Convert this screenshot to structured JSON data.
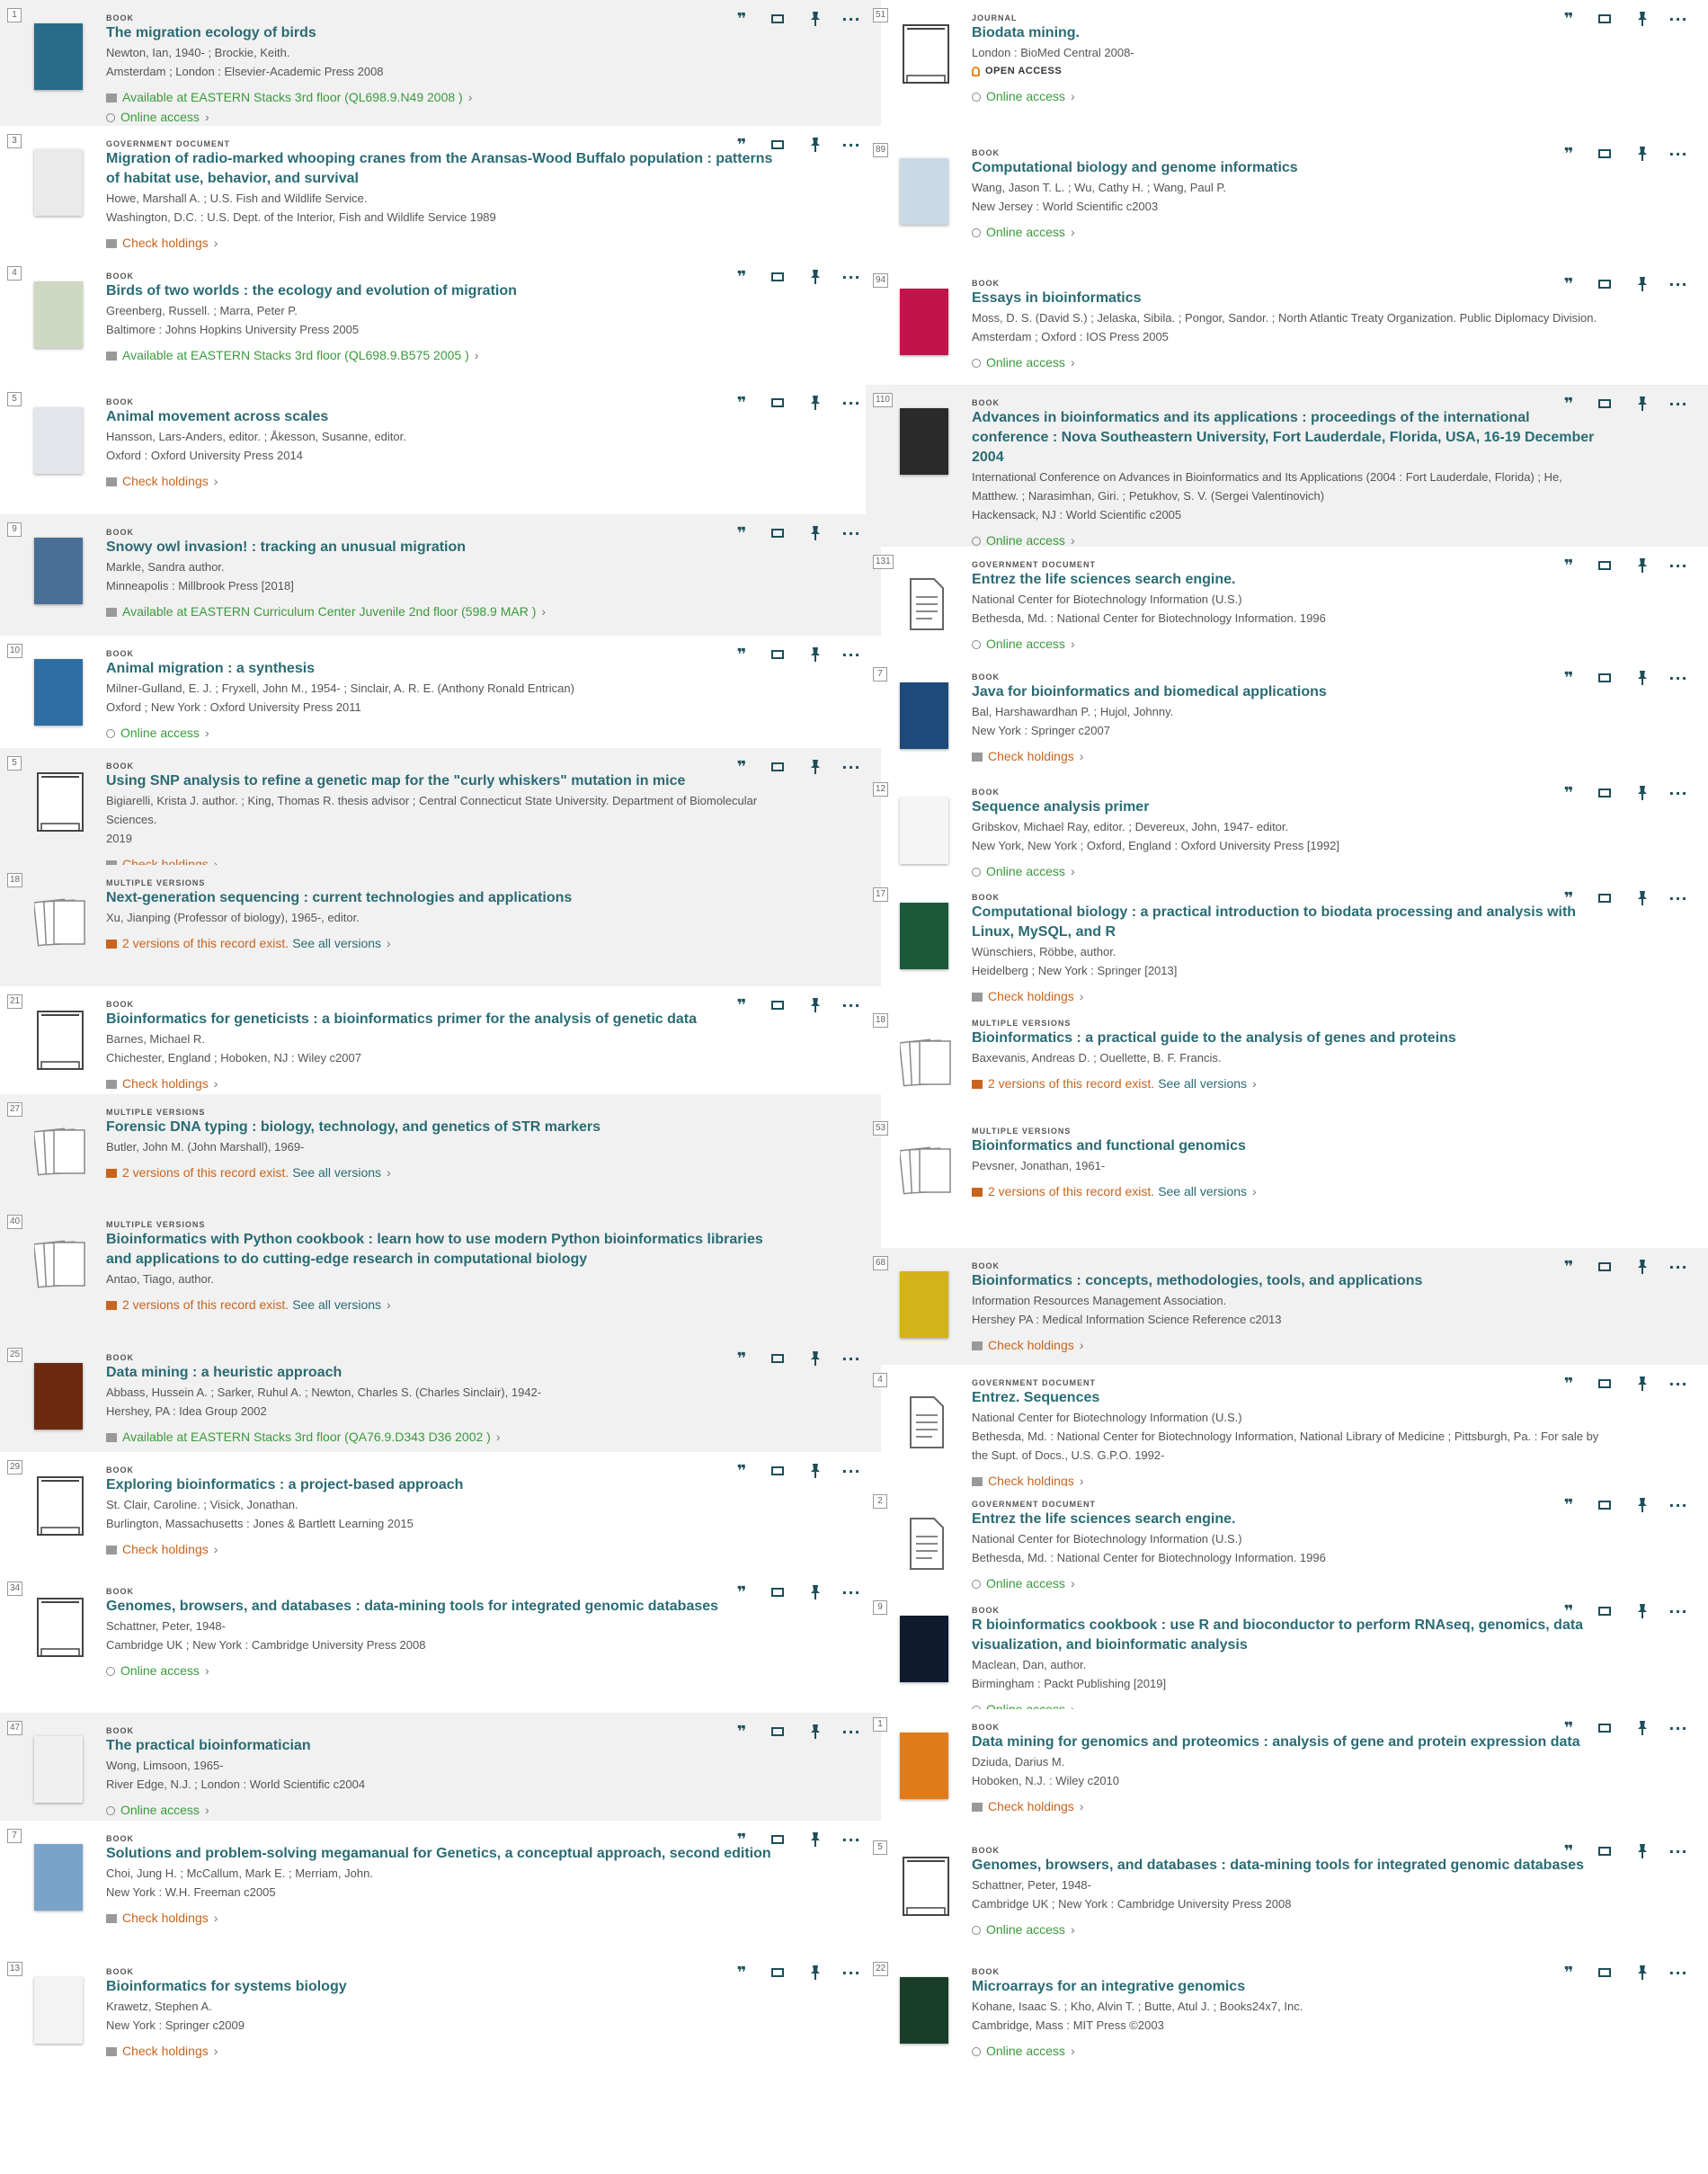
{
  "actions": {
    "cite_icon": "cite-icon",
    "email_icon": "email-icon",
    "pin_icon": "pin-icon",
    "more_icon": "more-icon",
    "cite_glyph": "❞",
    "pin_glyph": "📌",
    "more_glyph": "···"
  },
  "left": [
    {
      "num": "1",
      "type": "BOOK",
      "title": "The migration ecology of birds",
      "author": "Newton, Ian, 1940- ; Brockie, Keith.",
      "pub": "Amsterdam ; London : Elsevier-Academic Press 2008",
      "status": "Available at EASTERN  Stacks 3rd floor (QL698.9.N49 2008 )",
      "status2": "Online access"
    },
    {
      "num": "3",
      "type": "GOVERNMENT DOCUMENT",
      "title": "Migration of radio-marked whooping cranes from the Aransas-Wood Buffalo population : patterns of habitat use, behavior, and survival",
      "author": "Howe, Marshall A. ; U.S. Fish and Wildlife Service.",
      "pub": "Washington, D.C. : U.S. Dept. of the Interior, Fish and Wildlife Service 1989",
      "status": "Check holdings"
    },
    {
      "num": "4",
      "type": "BOOK",
      "title": "Birds of two worlds : the ecology and evolution of migration",
      "author": "Greenberg, Russell. ; Marra, Peter P.",
      "pub": "Baltimore : Johns Hopkins University Press 2005",
      "status": "Available at EASTERN  Stacks 3rd floor (QL698.9.B575 2005 )"
    },
    {
      "num": "5",
      "type": "BOOK",
      "title": "Animal movement across scales",
      "author": "Hansson, Lars-Anders, editor. ; Åkesson, Susanne, editor.",
      "pub": "Oxford : Oxford University Press 2014",
      "status": "Check holdings"
    },
    {
      "num": "9",
      "type": "BOOK",
      "title": "Snowy owl invasion! : tracking an unusual migration",
      "author": "Markle, Sandra author.",
      "pub": "Minneapolis : Millbrook Press [2018]",
      "status": "Available at EASTERN  Curriculum Center Juvenile 2nd floor (598.9 MAR )"
    },
    {
      "num": "10",
      "type": "BOOK",
      "title": "Animal migration : a synthesis",
      "author": "Milner-Gulland, E. J. ; Fryxell, John M., 1954- ; Sinclair, A. R. E. (Anthony Ronald Entrican)",
      "pub": "Oxford ; New York : Oxford University Press 2011",
      "status": "Online access"
    },
    {
      "num": "5",
      "type": "BOOK",
      "title": "Using SNP analysis to refine a genetic map for the \"curly whiskers\" mutation in mice",
      "author": "Bigiarelli, Krista J. author. ; King, Thomas R. thesis advisor ; Central Connecticut State University. Department of Biomolecular Sciences.",
      "pub": "2019",
      "status": "Check holdings"
    },
    {
      "num": "18",
      "type": "MULTIPLE VERSIONS",
      "title": "Next-generation sequencing : current technologies and applications",
      "author": "Xu, Jianping (Professor of biology), 1965-, editor.",
      "pub": "",
      "status": "2 versions of this record exist.",
      "see": "See all versions"
    },
    {
      "num": "21",
      "type": "BOOK",
      "title": "Bioinformatics for geneticists : a bioinformatics primer for the analysis of genetic data",
      "author": "Barnes, Michael R.",
      "pub": "Chichester, England ; Hoboken, NJ : Wiley c2007",
      "status": "Check holdings"
    },
    {
      "num": "27",
      "type": "MULTIPLE VERSIONS",
      "title": "Forensic DNA typing : biology, technology, and genetics of STR markers",
      "author": "Butler, John M. (John Marshall), 1969-",
      "pub": "",
      "status": "2 versions of this record exist.",
      "see": "See all versions"
    },
    {
      "num": "40",
      "type": "MULTIPLE VERSIONS",
      "title": "Bioinformatics with Python cookbook : learn how to use modern Python bioinformatics libraries and applications to do cutting-edge research in computational biology",
      "author": "Antao, Tiago, author.",
      "pub": "",
      "status": "2 versions of this record exist.",
      "see": "See all versions"
    },
    {
      "num": "25",
      "type": "BOOK",
      "title": "Data mining : a heuristic approach",
      "author": "Abbass, Hussein A. ; Sarker, Ruhul A. ; Newton, Charles S. (Charles Sinclair), 1942-",
      "pub": "Hershey, PA : Idea Group 2002",
      "status": "Available at EASTERN  Stacks 3rd floor (QA76.9.D343 D36 2002 )"
    },
    {
      "num": "29",
      "type": "BOOK",
      "title": "Exploring bioinformatics : a project-based approach",
      "author": "St. Clair, Caroline. ; Visick, Jonathan.",
      "pub": "Burlington, Massachusetts : Jones & Bartlett Learning 2015",
      "status": "Check holdings"
    },
    {
      "num": "34",
      "type": "BOOK",
      "title": "Genomes, browsers, and databases : data-mining tools for integrated genomic databases",
      "author": "Schattner, Peter, 1948-",
      "pub": "Cambridge UK ; New York : Cambridge University Press 2008",
      "status": "Online access"
    },
    {
      "num": "47",
      "type": "BOOK",
      "title": "The practical bioinformatician",
      "author": "Wong, Limsoon, 1965-",
      "pub": "River Edge, N.J. ; London : World Scientific c2004",
      "status": "Online access"
    },
    {
      "num": "7",
      "type": "BOOK",
      "title": "Solutions and problem-solving megamanual for Genetics, a conceptual approach, second edition",
      "author": "Choi, Jung H. ; McCallum, Mark E. ; Merriam, John.",
      "pub": "New York : W.H. Freeman c2005",
      "status": "Check holdings"
    },
    {
      "num": "13",
      "type": "BOOK",
      "title": "Bioinformatics for systems biology",
      "author": "Krawetz, Stephen A.",
      "pub": "New York : Springer c2009",
      "status": "Check holdings"
    }
  ],
  "right": [
    {
      "num": "51",
      "type": "JOURNAL",
      "title": "Biodata mining.",
      "author": "London : BioMed Central 2008-",
      "pub": "",
      "oa": "OPEN ACCESS",
      "status": "Online access"
    },
    {
      "num": "89",
      "type": "BOOK",
      "title": "Computational biology and genome informatics",
      "author": "Wang, Jason T. L. ; Wu, Cathy H. ; Wang, Paul P.",
      "pub": "New Jersey : World Scientific c2003",
      "status": "Online access"
    },
    {
      "num": "94",
      "type": "BOOK",
      "title": "Essays in bioinformatics",
      "author": "Moss, D. S. (David S.) ; Jelaska, Sibila. ; Pongor, Sandor. ; North Atlantic Treaty Organization. Public Diplomacy Division.",
      "pub": "Amsterdam ; Oxford : IOS Press 2005",
      "status": "Online access"
    },
    {
      "num": "110",
      "type": "BOOK",
      "title": "Advances in bioinformatics and its applications : proceedings of the international conference : Nova Southeastern University, Fort Lauderdale, Florida, USA, 16-19 December 2004",
      "author": "International Conference on Advances in Bioinformatics and Its Applications (2004 : Fort Lauderdale, Florida) ; He, Matthew. ; Narasimhan, Giri. ; Petukhov, S. V. (Sergei Valentinovich)",
      "pub": "Hackensack, NJ : World Scientific c2005",
      "status": "Online access"
    },
    {
      "num": "131",
      "type": "GOVERNMENT DOCUMENT",
      "title": "Entrez the life sciences search engine.",
      "author": "National Center for Biotechnology Information (U.S.)",
      "pub": "Bethesda, Md. : National Center for Biotechnology Information. 1996",
      "status": "Online access"
    },
    {
      "num": "7",
      "type": "BOOK",
      "title": "Java for bioinformatics and biomedical applications",
      "author": "Bal, Harshawardhan P. ; Hujol, Johnny.",
      "pub": "New York : Springer c2007",
      "status": "Check holdings"
    },
    {
      "num": "12",
      "type": "BOOK",
      "title": "Sequence analysis primer",
      "author": "Gribskov, Michael Ray, editor. ; Devereux, John, 1947- editor.",
      "pub": "New York, New York ; Oxford, England : Oxford University Press [1992]",
      "status": "Online access"
    },
    {
      "num": "17",
      "type": "BOOK",
      "title": "Computational biology : a practical introduction to biodata processing and analysis with Linux, MySQL, and R",
      "author": "Wünschiers, Röbbe, author.",
      "pub": "Heidelberg ; New York : Springer [2013]",
      "status": "Check holdings"
    },
    {
      "num": "18",
      "type": "MULTIPLE VERSIONS",
      "title": "Bioinformatics : a practical guide to the analysis of genes and proteins",
      "author": "Baxevanis, Andreas D. ; Ouellette, B. F. Francis.",
      "pub": "",
      "status": "2 versions of this record exist.",
      "see": "See all versions"
    },
    {
      "num": "53",
      "type": "MULTIPLE VERSIONS",
      "title": "Bioinformatics and functional genomics",
      "author": "Pevsner, Jonathan, 1961-",
      "pub": "",
      "status": "2 versions of this record exist.",
      "see": "See all versions"
    },
    {
      "num": "68",
      "type": "BOOK",
      "title": "Bioinformatics : concepts, methodologies, tools, and applications",
      "author": "Information Resources Management Association.",
      "pub": "Hershey PA : Medical Information Science Reference c2013",
      "status": "Check holdings"
    },
    {
      "num": "4",
      "type": "GOVERNMENT DOCUMENT",
      "title": "Entrez. Sequences",
      "author": "National Center for Biotechnology Information (U.S.)",
      "pub": "Bethesda, Md. : National Center for Biotechnology Information, National Library of Medicine ; Pittsburgh, Pa. : For sale by the Supt. of Docs., U.S. G.P.O. 1992-",
      "status": "Check holdings"
    },
    {
      "num": "2",
      "type": "GOVERNMENT DOCUMENT",
      "title": "Entrez the life sciences search engine.",
      "author": "National Center for Biotechnology Information (U.S.)",
      "pub": "Bethesda, Md. : National Center for Biotechnology Information. 1996",
      "status": "Online access"
    },
    {
      "num": "9",
      "type": "BOOK",
      "title": "R bioinformatics cookbook : use R and bioconductor to perform RNAseq, genomics, data visualization, and bioinformatic analysis",
      "author": "Maclean, Dan, author.",
      "pub": "Birmingham : Packt Publishing [2019]",
      "status": "Online access"
    },
    {
      "num": "1",
      "type": "BOOK",
      "title": "Data mining for genomics and proteomics : analysis of gene and protein expression data",
      "author": "Dziuda, Darius M.",
      "pub": "Hoboken, N.J. : Wiley c2010",
      "status": "Check holdings"
    },
    {
      "num": "5",
      "type": "BOOK",
      "title": "Genomes, browsers, and databases : data-mining tools for integrated genomic databases",
      "author": "Schattner, Peter, 1948-",
      "pub": "Cambridge UK ; New York : Cambridge University Press 2008",
      "status": "Online access"
    },
    {
      "num": "22",
      "type": "BOOK",
      "title": "Microarrays for an integrative genomics",
      "author": "Kohane, Isaac S. ; Kho, Alvin T. ; Butte, Atul J. ; Books24x7, Inc.",
      "pub": "Cambridge, Mass : MIT Press ©2003",
      "status": "Online access"
    }
  ]
}
